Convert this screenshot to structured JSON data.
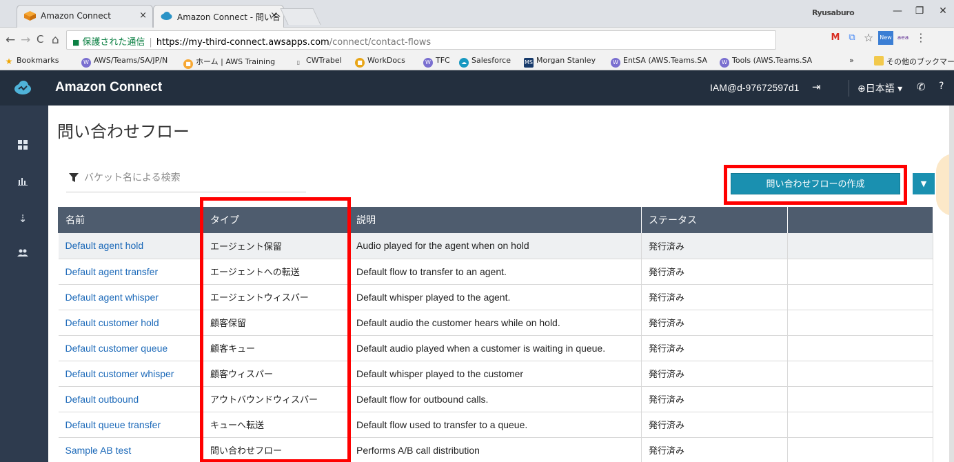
{
  "browser": {
    "tabs": [
      {
        "title": "Amazon Connect",
        "close": "×"
      },
      {
        "title": "Amazon Connect - 問い合",
        "close": "×"
      }
    ],
    "profile": "Ryusaburo",
    "window": {
      "minimize": "—",
      "restore": "❐",
      "close": "✕"
    },
    "nav": {
      "back": "←",
      "forward": "→",
      "reload": "C",
      "home": "⌂"
    },
    "secure_label": "保護された通信",
    "url_host": "https://my-third-connect.awsapps.com",
    "url_path": "/connect/contact-flows",
    "extensions": [
      "M",
      "⧉",
      "☆",
      "New",
      "aea",
      "⋮"
    ],
    "bookmarks": [
      {
        "label": "Bookmarks",
        "icon": "star-icon"
      },
      {
        "label": "AWS/Teams/SA/JP/N",
        "icon": "w-icon"
      },
      {
        "label": "ホーム | AWS Training ",
        "icon": "aws-icon"
      },
      {
        "label": "CWTrabel",
        "icon": "page-icon"
      },
      {
        "label": "WorkDocs",
        "icon": "workdocs-icon"
      },
      {
        "label": "TFC",
        "icon": "w-icon"
      },
      {
        "label": "Salesforce",
        "icon": "salesforce-icon"
      },
      {
        "label": "Morgan Stanley",
        "icon": "ms-icon"
      },
      {
        "label": "EntSA (AWS.Teams.SA",
        "icon": "w-icon"
      },
      {
        "label": "Tools (AWS.Teams.SA",
        "icon": "w-icon"
      },
      {
        "label": "»",
        "icon": ""
      },
      {
        "label": "その他のブックマーク",
        "icon": "folder-icon"
      }
    ]
  },
  "app": {
    "title": "Amazon Connect",
    "user": "IAM@d-97672597d1",
    "language": "⊕日本語 ▾",
    "help": "?"
  },
  "page": {
    "title": "問い合わせフロー",
    "search_placeholder": "バケット名による検索",
    "create_button": "問い合わせフローの作成",
    "dropdown_glyph": "▼"
  },
  "table": {
    "headers": [
      "名前",
      "タイプ",
      "説明",
      "ステータス",
      ""
    ],
    "rows": [
      {
        "name": "Default agent hold",
        "type": "エージェント保留",
        "description": "Audio played for the agent when on hold",
        "status": "発行済み"
      },
      {
        "name": "Default agent transfer",
        "type": "エージェントへの転送",
        "description": "Default flow to transfer to an agent.",
        "status": "発行済み"
      },
      {
        "name": "Default agent whisper",
        "type": "エージェントウィスパー",
        "description": "Default whisper played to the agent.",
        "status": "発行済み"
      },
      {
        "name": "Default customer hold",
        "type": "顧客保留",
        "description": "Default audio the customer hears while on hold.",
        "status": "発行済み"
      },
      {
        "name": "Default customer queue",
        "type": "顧客キュー",
        "description": "Default audio played when a customer is waiting in queue.",
        "status": "発行済み"
      },
      {
        "name": "Default customer whisper",
        "type": "顧客ウィスパー",
        "description": "Default whisper played to the customer",
        "status": "発行済み"
      },
      {
        "name": "Default outbound",
        "type": "アウトバウンドウィスパー",
        "description": "Default flow for outbound calls.",
        "status": "発行済み"
      },
      {
        "name": "Default queue transfer",
        "type": "キューへ転送",
        "description": "Default flow used to transfer to a queue.",
        "status": "発行済み"
      },
      {
        "name": "Sample AB test",
        "type": "問い合わせフロー",
        "description": "Performs A/B call distribution",
        "status": "発行済み"
      }
    ]
  },
  "colors": {
    "header_bg": "#232f3e",
    "sidebar_bg": "#2e3b4e",
    "table_header_bg": "#4e5c6e",
    "primary_button": "#1a90b0",
    "highlight": "#ff0000",
    "link": "#1a68b8"
  }
}
